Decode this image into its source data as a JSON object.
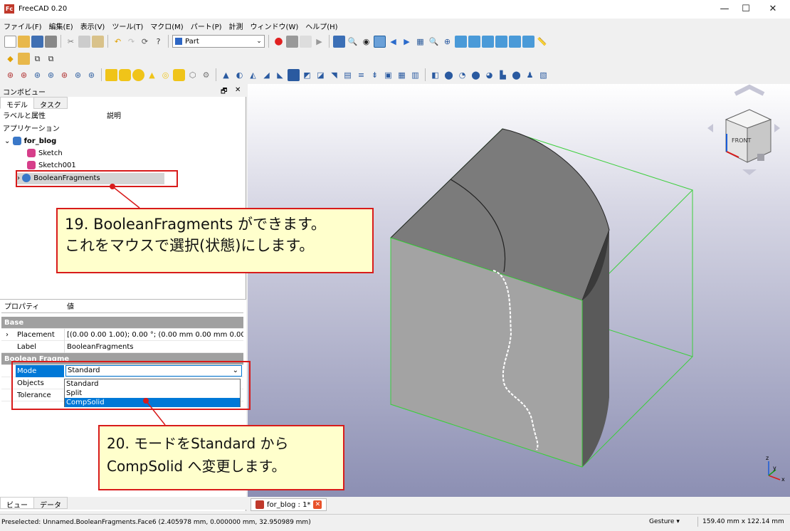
{
  "window": {
    "title": "FreeCAD 0.20",
    "icon": "Fc",
    "minimize": "—",
    "maximize": "☐",
    "close": "✕"
  },
  "menu": [
    "ファイル(F)",
    "編集(E)",
    "表示(V)",
    "ツール(T)",
    "マクロ(M)",
    "パート(P)",
    "計測",
    "ウィンドウ(W)",
    "ヘルプ(H)"
  ],
  "toolbar": {
    "workbench": "Part"
  },
  "combo_view": {
    "title": "コンボビュー",
    "float_icon": "🗗",
    "close_icon": "✕",
    "tabs": [
      "モデル",
      "タスク"
    ],
    "tree_headers": {
      "label": "ラベルと属性",
      "description": "説明"
    },
    "tree": {
      "application": "アプリケーション",
      "document": "for_blog",
      "items": [
        "Sketch",
        "Sketch001",
        "BooleanFragments"
      ]
    }
  },
  "properties": {
    "header_property": "プロパティ",
    "header_value": "値",
    "group_base": "Base",
    "placement_name": "Placement",
    "placement_value": "[(0.00 0.00 1.00); 0.00 °; (0.00 mm  0.00 mm  0.00 mm)]",
    "label_name": "Label",
    "label_value": "BooleanFragments",
    "group_bf": "Boolean Fragme",
    "mode_name": "Mode",
    "mode_value": "Standard",
    "objects_name": "Objects",
    "tolerance_name": "Tolerance",
    "mode_options": [
      "Standard",
      "Split",
      "CompSolid"
    ],
    "mode_selected_option": "CompSolid"
  },
  "bottom_tabs": [
    "ビュー",
    "データ"
  ],
  "document_tab": "for_blog : 1*",
  "status": {
    "preselected": "Preselected: Unnamed.BooleanFragments.Face6 (2.405978 mm, 0.000000 mm, 32.950989 mm)",
    "nav_style": "Gesture ▾",
    "dimensions": "159.40 mm x 122.14 mm"
  },
  "navcube": {
    "face": "FRONT"
  },
  "axis": {
    "x": "x",
    "y": "y",
    "z": "z"
  },
  "annotations": {
    "step19_line1": "19. BooleanFragments ができます。",
    "step19_line2": "これをマウスで選択(状態)にします。",
    "step20_line1": "20. モードをStandard から",
    "step20_line2": "CompSolid へ変更します。"
  },
  "colors": {
    "highlight": "#d81b1b",
    "callout_bg": "#ffffcc",
    "selection": "#0078d7",
    "edge_preselect": "#00cc33"
  }
}
